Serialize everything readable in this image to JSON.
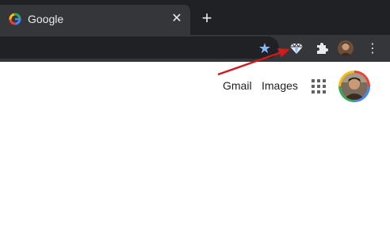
{
  "browser": {
    "tab": {
      "title": "Google",
      "close_glyph": "✕"
    },
    "new_tab_glyph": "+",
    "toolbar": {
      "star_glyph": "★",
      "menu_glyph": "⋮"
    }
  },
  "page": {
    "header_links": {
      "gmail": "Gmail",
      "images": "Images"
    }
  },
  "colors": {
    "chrome_dark": "#202124",
    "chrome_tab": "#35363a",
    "accent_blue": "#8ab4f8",
    "annotation_red": "#d11a1a"
  }
}
